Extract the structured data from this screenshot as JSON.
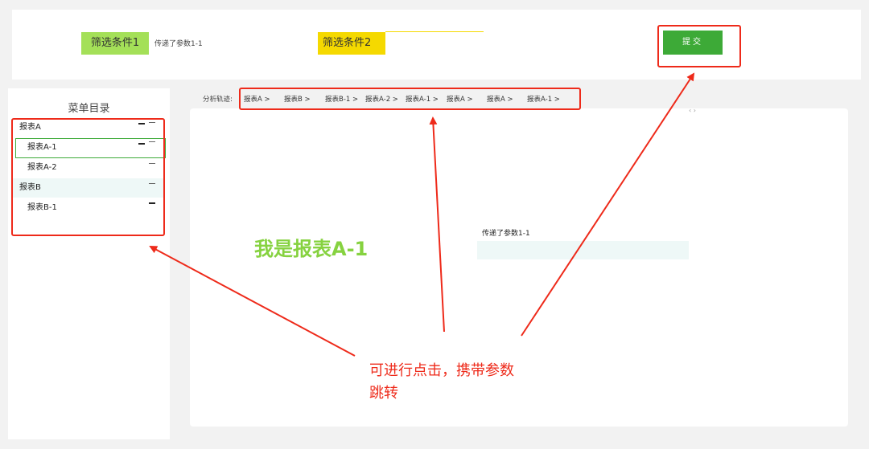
{
  "filters": {
    "filter1_label": "筛选条件1",
    "filter1_value": "传递了参数1-1",
    "filter2_label": "筛选条件2"
  },
  "submit_label": "提交",
  "menu": {
    "title": "菜单目录",
    "items": [
      {
        "label": "报表A"
      },
      {
        "label": "报表A-1"
      },
      {
        "label": "报表A-2"
      },
      {
        "label": "报表B"
      },
      {
        "label": "报表B-1"
      }
    ]
  },
  "breadcrumb": {
    "label": "分析轨迹:",
    "items": [
      "报表A >",
      "报表B >",
      "报表B-1 >",
      "报表A-2 >",
      "报表A-1 >",
      "报表A >",
      "报表A >",
      "报表A-1 >"
    ]
  },
  "content": {
    "heading": "我是报表A-1",
    "param_text": "传递了参数1-1",
    "collapse_icon": "‹ ›"
  },
  "annotation": {
    "line1": "可进行点击，携带参数",
    "line2": "跳转"
  },
  "colors": {
    "accent_green": "#3daa37",
    "filter1_bg": "#a4e058",
    "filter2_bg": "#f5d900",
    "annotation_red": "#ee2a1a",
    "heading_green": "#86d240"
  }
}
